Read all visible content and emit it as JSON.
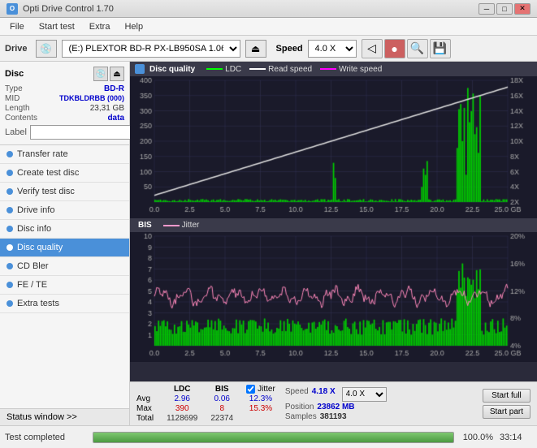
{
  "titleBar": {
    "title": "Opti Drive Control 1.70",
    "minBtn": "─",
    "maxBtn": "□",
    "closeBtn": "✕"
  },
  "menuBar": {
    "items": [
      "File",
      "Start test",
      "Extra",
      "Help"
    ]
  },
  "driveBar": {
    "label": "Drive",
    "driveValue": "(E:) PLEXTOR BD-R  PX-LB950SA 1.06",
    "speedLabel": "Speed",
    "speedValue": "4.0 X"
  },
  "disc": {
    "title": "Disc",
    "typeLabel": "Type",
    "typeValue": "BD-R",
    "midLabel": "MID",
    "midValue": "TDKBLDRBB (000)",
    "lengthLabel": "Length",
    "lengthValue": "23,31 GB",
    "contentsLabel": "Contents",
    "contentsValue": "data",
    "labelLabel": "Label",
    "labelValue": ""
  },
  "navItems": [
    {
      "id": "transfer-rate",
      "label": "Transfer rate",
      "active": false
    },
    {
      "id": "create-test-disc",
      "label": "Create test disc",
      "active": false
    },
    {
      "id": "verify-test-disc",
      "label": "Verify test disc",
      "active": false
    },
    {
      "id": "drive-info",
      "label": "Drive info",
      "active": false
    },
    {
      "id": "disc-info",
      "label": "Disc info",
      "active": false
    },
    {
      "id": "disc-quality",
      "label": "Disc quality",
      "active": true
    },
    {
      "id": "cd-bler",
      "label": "CD Bler",
      "active": false
    },
    {
      "id": "fe-te",
      "label": "FE / TE",
      "active": false
    },
    {
      "id": "extra-tests",
      "label": "Extra tests",
      "active": false
    }
  ],
  "statusWindowBtn": "Status window >>",
  "chartQuality": {
    "title": "Disc quality",
    "legend": [
      {
        "label": "LDC",
        "color": "#00ff00"
      },
      {
        "label": "Read speed",
        "color": "#ffffff"
      },
      {
        "label": "Write speed",
        "color": "#ff00ff"
      }
    ],
    "yAxisMax": 400,
    "yAxisRight": [
      "18X",
      "16X",
      "14X",
      "12X",
      "10X",
      "8X",
      "6X",
      "4X",
      "2X"
    ],
    "xAxisLabels": [
      "0.0",
      "2.5",
      "5.0",
      "7.5",
      "10.0",
      "12.5",
      "15.0",
      "17.5",
      "20.0",
      "22.5",
      "25.0 GB"
    ]
  },
  "chartBis": {
    "title": "BIS",
    "legend": [
      {
        "label": "Jitter",
        "color": "#ff99cc"
      }
    ],
    "yAxisMax": 10,
    "yAxisRight": [
      "20%",
      "16%",
      "12%",
      "8%",
      "4%"
    ],
    "xAxisLabels": [
      "0.0",
      "2.5",
      "5.0",
      "7.5",
      "10.0",
      "12.5",
      "15.0",
      "17.5",
      "20.0",
      "22.5",
      "25.0 GB"
    ]
  },
  "stats": {
    "columns": [
      {
        "header": "",
        "values": [
          "Avg",
          "Max",
          "Total"
        ]
      },
      {
        "header": "LDC",
        "values": [
          "2.96",
          "390",
          "1128699"
        ]
      },
      {
        "header": "BIS",
        "values": [
          "0.06",
          "8",
          "22374"
        ]
      }
    ],
    "jitter": {
      "checked": true,
      "label": "Jitter",
      "values": [
        "12.3%",
        "15.3%",
        ""
      ]
    },
    "speed": {
      "speedLabel": "Speed",
      "speedValue": "4.18 X",
      "speedSelect": "4.0 X",
      "positionLabel": "Position",
      "positionValue": "23862 MB",
      "samplesLabel": "Samples",
      "samplesValue": "381193"
    },
    "buttons": {
      "startFull": "Start full",
      "startPart": "Start part"
    }
  },
  "bottomBar": {
    "statusText": "Test completed",
    "progressPercent": 100,
    "progressLabel": "100.0%",
    "time": "33:14"
  }
}
